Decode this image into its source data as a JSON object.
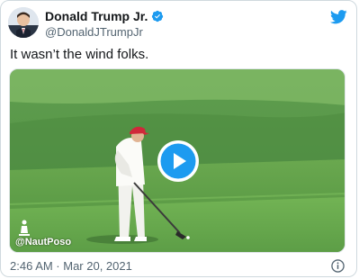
{
  "author": {
    "display_name": "Donald Trump Jr.",
    "handle": "@DonaldJTrumpJr",
    "verified": true
  },
  "tweet": {
    "text": "It wasn’t the wind folks.",
    "timestamp": "2:46 AM · Mar 20, 2021"
  },
  "media": {
    "type": "video",
    "watermark": "@NautPoso"
  },
  "icons": {
    "brand": "twitter-bird-icon",
    "verified": "verified-badge-icon",
    "play": "play-icon",
    "info": "info-icon"
  },
  "colors": {
    "brand_blue": "#1d9bf0",
    "text_primary": "#14171a",
    "text_secondary": "#536471",
    "border": "#cfd9de"
  }
}
